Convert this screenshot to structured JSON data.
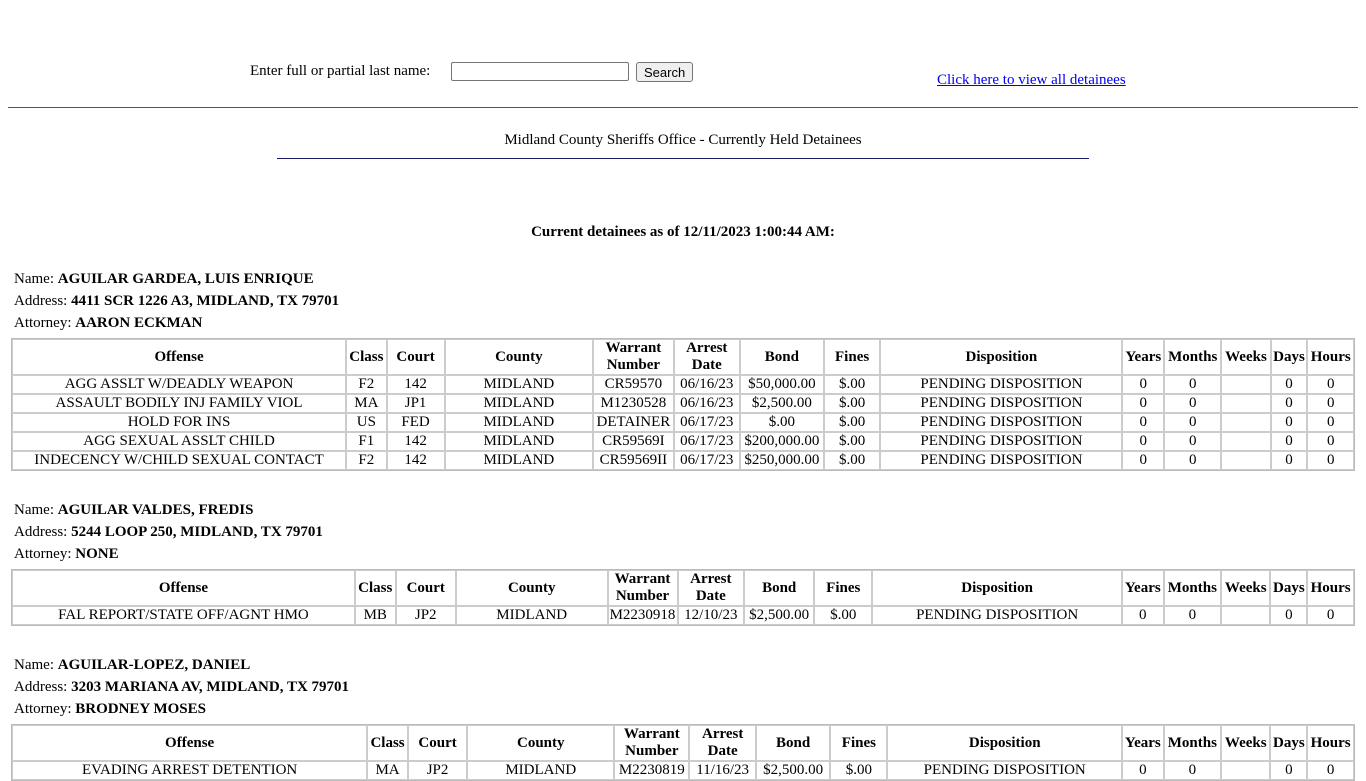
{
  "search": {
    "label": "Enter full or partial last name:",
    "placeholder": "",
    "button": "Search"
  },
  "view_all_link": "Click here to view all detainees",
  "page_title": "Midland County Sheriffs Office - Currently Held Detainees",
  "as_of": "Current detainees as of 12/11/2023 1:00:44 AM:",
  "labels": {
    "name": "Name:",
    "address": "Address:",
    "attorney": "Attorney:"
  },
  "columns": [
    "Offense",
    "Class",
    "Court",
    "County",
    "Warrant Number",
    "Arrest Date",
    "Bond",
    "Fines",
    "Disposition",
    "Years",
    "Months",
    "Weeks",
    "Days",
    "Hours"
  ],
  "detainees": [
    {
      "name": "AGUILAR GARDEA, LUIS ENRIQUE",
      "address": "4411 SCR 1226 A3, MIDLAND, TX 79701",
      "attorney": "AARON ECKMAN",
      "charges": [
        [
          "AGG ASSLT W/DEADLY WEAPON",
          "F2",
          "142",
          "MIDLAND",
          "CR59570",
          "06/16/23",
          "$50,000.00",
          "$.00",
          "PENDING DISPOSITION",
          "0",
          "0",
          "",
          "0",
          "0"
        ],
        [
          "ASSAULT BODILY INJ FAMILY VIOL",
          "MA",
          "JP1",
          "MIDLAND",
          "M1230528",
          "06/16/23",
          "$2,500.00",
          "$.00",
          "PENDING DISPOSITION",
          "0",
          "0",
          "",
          "0",
          "0"
        ],
        [
          "HOLD FOR INS",
          "US",
          "FED",
          "MIDLAND",
          "DETAINER",
          "06/17/23",
          "$.00",
          "$.00",
          "PENDING DISPOSITION",
          "0",
          "0",
          "",
          "0",
          "0"
        ],
        [
          "AGG SEXUAL ASSLT CHILD",
          "F1",
          "142",
          "MIDLAND",
          "CR59569I",
          "06/17/23",
          "$200,000.00",
          "$.00",
          "PENDING DISPOSITION",
          "0",
          "0",
          "",
          "0",
          "0"
        ],
        [
          "INDECENCY W/CHILD SEXUAL CONTACT",
          "F2",
          "142",
          "MIDLAND",
          "CR59569II",
          "06/17/23",
          "$250,000.00",
          "$.00",
          "PENDING DISPOSITION",
          "0",
          "0",
          "",
          "0",
          "0"
        ]
      ]
    },
    {
      "name": "AGUILAR VALDES, FREDIS",
      "address": "5244 LOOP 250, MIDLAND, TX 79701",
      "attorney": "NONE",
      "charges": [
        [
          "FAL REPORT/STATE OFF/AGNT HMO",
          "MB",
          "JP2",
          "MIDLAND",
          "M2230918",
          "12/10/23",
          "$2,500.00",
          "$.00",
          "PENDING DISPOSITION",
          "0",
          "0",
          "",
          "0",
          "0"
        ]
      ]
    },
    {
      "name": "AGUILAR-LOPEZ, DANIEL",
      "address": "3203 MARIANA AV, MIDLAND, TX 79701",
      "attorney": "BRODNEY MOSES",
      "charges": [
        [
          "EVADING ARREST DETENTION",
          "MA",
          "JP2",
          "MIDLAND",
          "M2230819",
          "11/16/23",
          "$2,500.00",
          "$.00",
          "PENDING DISPOSITION",
          "0",
          "0",
          "",
          "0",
          "0"
        ]
      ]
    }
  ]
}
